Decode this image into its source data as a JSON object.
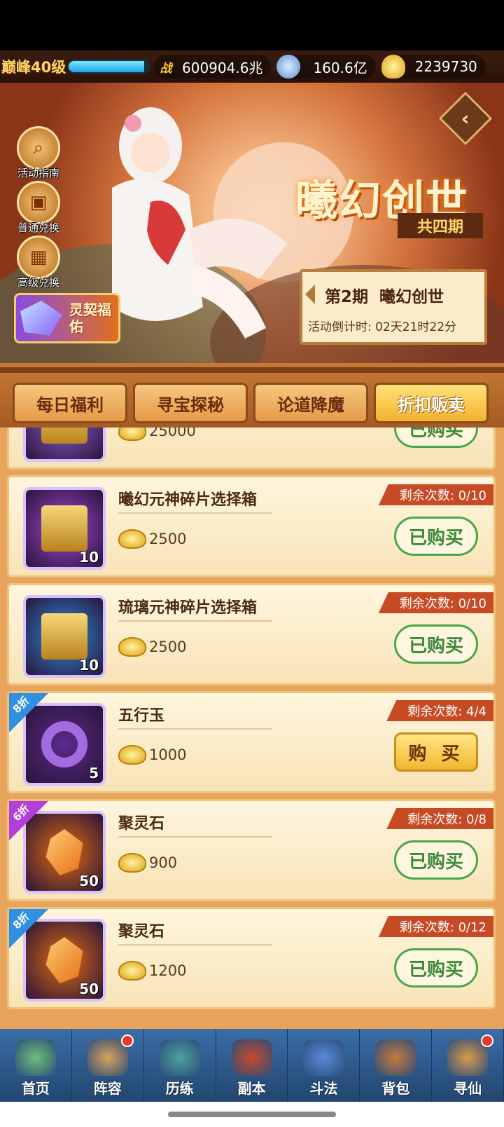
{
  "resources": {
    "level": "巅峰40级",
    "xp_fraction": 0.95,
    "power_icon": "战",
    "power": "600904.6兆",
    "coin": "160.6亿",
    "gold": "2239730"
  },
  "banner": {
    "title": "曦幻创世",
    "subtitle": "共四期",
    "side_buttons": [
      "活动指南",
      "普通兑换",
      "高级兑换"
    ],
    "promo": "灵契福佑",
    "period": "第2期  曦幻创世",
    "countdown": "活动倒计时: 02天21时22分"
  },
  "tabs": [
    "每日福利",
    "寻宝探秘",
    "论道降魔",
    "折扣贩卖"
  ],
  "items": [
    {
      "name": "",
      "price": "25000",
      "remain": "",
      "button": "已购买",
      "qty": "",
      "discount": "",
      "icon_color": "#8f5cd6"
    },
    {
      "name": "曦幻元神碎片选择箱",
      "price": "2500",
      "remain": "剩余次数: 0/10",
      "button": "已购买",
      "qty": "10",
      "discount": "",
      "icon_color": "#a047d9"
    },
    {
      "name": "琉璃元神碎片选择箱",
      "price": "2500",
      "remain": "剩余次数: 0/10",
      "button": "已购买",
      "qty": "10",
      "discount": "",
      "icon_color": "#2a8ee0"
    },
    {
      "name": "五行玉",
      "price": "1000",
      "remain": "剩余次数: 4/4",
      "button": "购 买",
      "qty": "5",
      "discount": "8折",
      "icon_color": "#5a2a8a"
    },
    {
      "name": "聚灵石",
      "price": "900",
      "remain": "剩余次数: 0/8",
      "button": "已购买",
      "qty": "50",
      "discount": "6折",
      "icon_color": "#e06c12"
    },
    {
      "name": "聚灵石",
      "price": "1200",
      "remain": "剩余次数: 0/12",
      "button": "已购买",
      "qty": "50",
      "discount": "8折",
      "icon_color": "#e06c12"
    }
  ],
  "nav": [
    "首页",
    "阵容",
    "历练",
    "副本",
    "斗法",
    "背包",
    "寻仙"
  ],
  "nav_dots": [
    false,
    true,
    false,
    false,
    false,
    false,
    true
  ]
}
